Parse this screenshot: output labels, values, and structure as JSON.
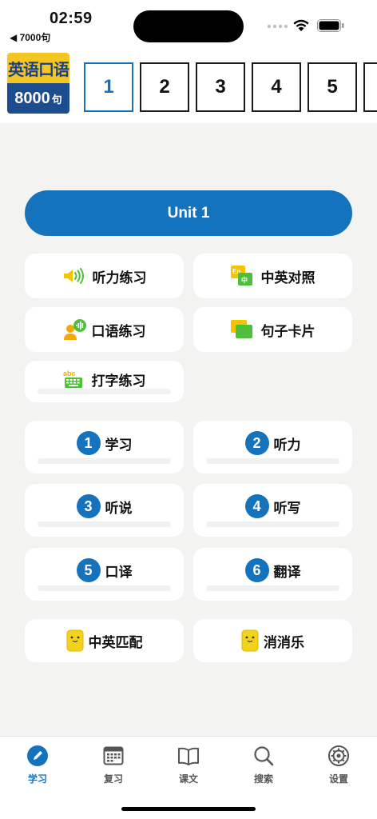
{
  "status": {
    "time": "02:59",
    "back_app": "◀ 7000句"
  },
  "logo": {
    "top": "英语口语",
    "bottom_number": "8000",
    "bottom_suffix": "句"
  },
  "units": [
    "1",
    "2",
    "3",
    "4",
    "5"
  ],
  "active_unit": "1",
  "unit_banner": "Unit 1",
  "practice": {
    "listening": "听力练习",
    "compare": "中英对照",
    "speaking": "口语练习",
    "cards": "句子卡片",
    "typing": "打字练习"
  },
  "icon_text": {
    "en": "En",
    "zh": "中",
    "abc": "abc"
  },
  "steps": [
    {
      "num": "1",
      "label": "学习"
    },
    {
      "num": "2",
      "label": "听力"
    },
    {
      "num": "3",
      "label": "听说"
    },
    {
      "num": "4",
      "label": "听写"
    },
    {
      "num": "5",
      "label": "口译"
    },
    {
      "num": "6",
      "label": "翻译"
    }
  ],
  "games": {
    "match": "中英匹配",
    "eliminate": "消消乐"
  },
  "tabs": [
    {
      "label": "学习",
      "icon": "pencil-icon"
    },
    {
      "label": "复习",
      "icon": "calendar-icon"
    },
    {
      "label": "课文",
      "icon": "book-icon"
    },
    {
      "label": "搜索",
      "icon": "search-icon"
    },
    {
      "label": "设置",
      "icon": "gear-icon"
    }
  ],
  "colors": {
    "accent": "#1572bd",
    "logo_yellow": "#f3c623",
    "logo_blue": "#1d4c8f",
    "icon_green": "#4fbf3a",
    "icon_yellow": "#f2c500"
  }
}
